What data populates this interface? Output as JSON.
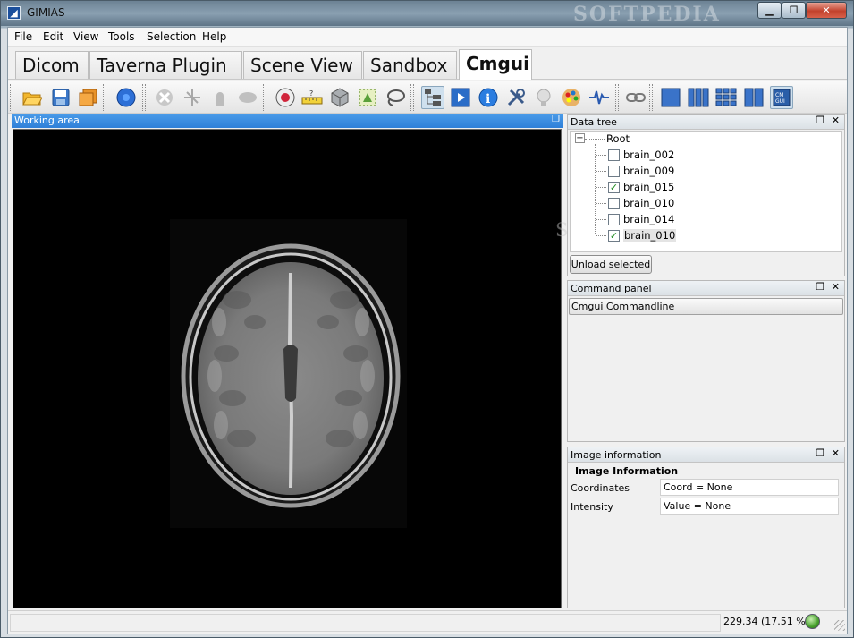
{
  "window": {
    "title": "GIMIAS",
    "watermark": "SOFTPEDIA"
  },
  "menu": [
    "File",
    "Edit",
    "View",
    "Tools",
    "Selection",
    "Help"
  ],
  "tabs": [
    "Dicom",
    "Taverna Plugin",
    "Scene View",
    "Sandbox",
    "Cmgui"
  ],
  "active_tab": "Cmgui",
  "toolbar": {
    "icons": [
      "open-folder-icon",
      "save-icon",
      "save-all-icon",
      "sphere-icon",
      "remove-icon",
      "crosshair-icon",
      "fill-icon",
      "ellipse-icon",
      "record-icon",
      "measure-icon",
      "cube-icon",
      "region-icon",
      "lasso-icon",
      "data-tree-icon",
      "play-icon",
      "info-icon",
      "tools-icon",
      "lightbulb-icon",
      "palette-icon",
      "signal-icon",
      "link-icon",
      "single-view-icon",
      "columns-view-icon",
      "grid-view-icon",
      "two-view-icon",
      "cmgui-view-icon"
    ],
    "pressed": [
      "data-tree-icon",
      "cmgui-view-icon"
    ]
  },
  "working_area": {
    "title": "Working area"
  },
  "data_tree": {
    "title": "Data tree",
    "root": "Root",
    "items": [
      {
        "label": "brain_002",
        "checked": false
      },
      {
        "label": "brain_009",
        "checked": false
      },
      {
        "label": "brain_015",
        "checked": true
      },
      {
        "label": "brain_010",
        "checked": false
      },
      {
        "label": "brain_014",
        "checked": false
      },
      {
        "label": "brain_010",
        "checked": true
      }
    ],
    "unload_button": "Unload selected"
  },
  "command_panel": {
    "title": "Command panel",
    "button": "Cmgui Commandline"
  },
  "image_info": {
    "title": "Image information",
    "heading": "Image Information",
    "rows": [
      {
        "label": "Coordinates",
        "value": "Coord = None"
      },
      {
        "label": "Intensity",
        "value": "Value = None"
      }
    ]
  },
  "status": {
    "zoom": "229.34  (17.51 %)"
  }
}
